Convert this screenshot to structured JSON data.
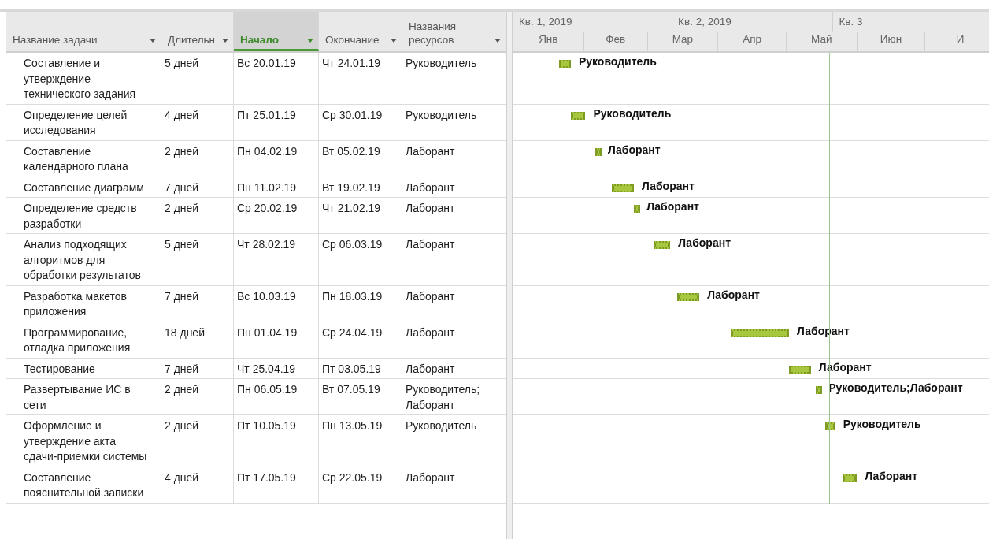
{
  "columns": [
    {
      "label": "Название задачи",
      "selected": false
    },
    {
      "label": "Длительн",
      "selected": false
    },
    {
      "label": "Начало",
      "selected": true
    },
    {
      "label": "Окончание",
      "selected": false
    },
    {
      "label": "Названия ресурсов",
      "selected": false
    }
  ],
  "timescale": {
    "quarters": [
      "Кв. 1, 2019",
      "Кв. 2, 2019",
      "Кв. 3"
    ],
    "months": [
      "Янв",
      "Фев",
      "Мар",
      "Апр",
      "Май",
      "Июн",
      "И"
    ]
  },
  "tasks": [
    {
      "name": "Составление и утверждение технического задания",
      "duration": "5 дней",
      "start": "Вс 20.01.19",
      "end": "Чт 24.01.19",
      "resources": "Руководитель",
      "bar_label": "Руководитель"
    },
    {
      "name": "Определение целей исследования",
      "duration": "4 дней",
      "start": "Пт 25.01.19",
      "end": "Ср 30.01.19",
      "resources": "Руководитель",
      "bar_label": "Руководитель"
    },
    {
      "name": "Составление календарного плана",
      "duration": "2 дней",
      "start": "Пн 04.02.19",
      "end": "Вт 05.02.19",
      "resources": "Лаборант",
      "bar_label": "Лаборант"
    },
    {
      "name": "Составление диаграмм",
      "duration": "7 дней",
      "start": "Пн 11.02.19",
      "end": "Вт 19.02.19",
      "resources": "Лаборант",
      "bar_label": "Лаборант"
    },
    {
      "name": "Определение средств разработки",
      "duration": "2 дней",
      "start": "Ср 20.02.19",
      "end": "Чт 21.02.19",
      "resources": "Лаборант",
      "bar_label": "Лаборант"
    },
    {
      "name": "Анализ подходящих алгоритмов для обработки результатов",
      "duration": "5 дней",
      "start": "Чт 28.02.19",
      "end": "Ср 06.03.19",
      "resources": "Лаборант",
      "bar_label": "Лаборант"
    },
    {
      "name": "Разработка макетов приложения",
      "duration": "7 дней",
      "start": "Вс 10.03.19",
      "end": "Пн 18.03.19",
      "resources": "Лаборант",
      "bar_label": "Лаборант"
    },
    {
      "name": "Программирование, отладка приложения",
      "duration": "18 дней",
      "start": "Пн 01.04.19",
      "end": "Ср 24.04.19",
      "resources": "Лаборант",
      "bar_label": "Лаборант"
    },
    {
      "name": "Тестирование",
      "duration": "7 дней",
      "start": "Чт 25.04.19",
      "end": "Пт 03.05.19",
      "resources": "Лаборант",
      "bar_label": "Лаборант"
    },
    {
      "name": "Развертывание ИС в сети",
      "duration": "2 дней",
      "start": "Пн 06.05.19",
      "end": "Вт 07.05.19",
      "resources": "Руководитель; Лаборант",
      "bar_label": "Руководитель;Лаборант"
    },
    {
      "name": "Оформление и утверждение акта сдачи-приемки системы",
      "duration": "2 дней",
      "start": "Пт 10.05.19",
      "end": "Пн 13.05.19",
      "resources": "Руководитель",
      "bar_label": "Руководитель"
    },
    {
      "name": "Составление пояснительной записки",
      "duration": "4 дней",
      "start": "Пт 17.05.19",
      "end": "Ср 22.05.19",
      "resources": "Лаборант",
      "bar_label": "Лаборант"
    }
  ]
}
